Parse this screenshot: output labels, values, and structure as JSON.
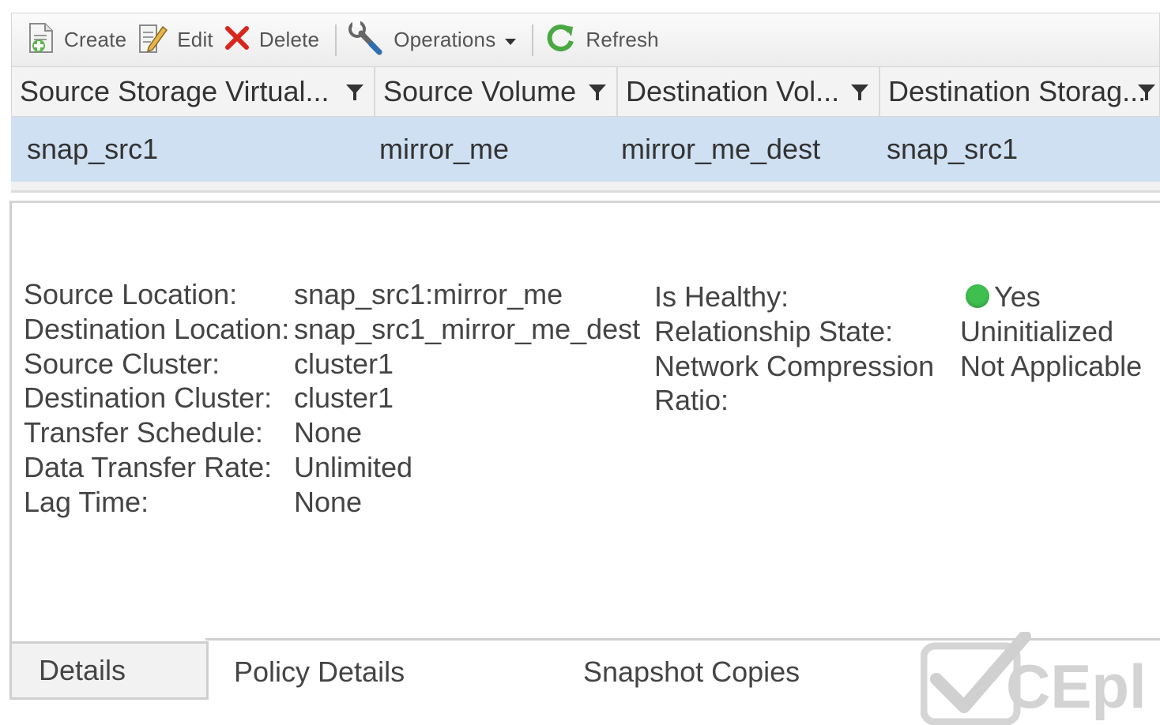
{
  "toolbar": {
    "create_label": "Create",
    "edit_label": "Edit",
    "delete_label": "Delete",
    "operations_label": "Operations",
    "refresh_label": "Refresh"
  },
  "grid": {
    "columns": [
      "Source Storage Virtual...",
      "Source Volume",
      "Destination Vol...",
      "Destination Storag..."
    ],
    "rows": [
      [
        "snap_src1",
        "mirror_me",
        "mirror_me_dest",
        "snap_src1"
      ]
    ]
  },
  "details": {
    "left": [
      {
        "label": "Source Location:",
        "value": "snap_src1:mirror_me"
      },
      {
        "label": "Destination Location:",
        "value": "snap_src1_mirror_me_dest"
      },
      {
        "label": "Source Cluster:",
        "value": "cluster1"
      },
      {
        "label": "Destination Cluster:",
        "value": "cluster1"
      },
      {
        "label": "Transfer Schedule:",
        "value": "None"
      },
      {
        "label": "Data Transfer Rate:",
        "value": "Unlimited"
      },
      {
        "label": "Lag Time:",
        "value": "None"
      }
    ],
    "right": [
      {
        "label": "Is Healthy:",
        "value": "Yes"
      },
      {
        "label": "Relationship State:",
        "value": "Uninitialized"
      },
      {
        "label": "Network Compression",
        "value": "Not Applicable"
      },
      {
        "label": "Ratio:",
        "value": ""
      }
    ]
  },
  "tabs": [
    "Details",
    "Policy Details",
    "Snapshot Copies"
  ],
  "watermark_text": "CEpl",
  "colors": {
    "selected_row": "#cfe0f2",
    "healthy": "#3fbf4f",
    "delete_red": "#d9261c",
    "refresh_green": "#4aa843"
  }
}
